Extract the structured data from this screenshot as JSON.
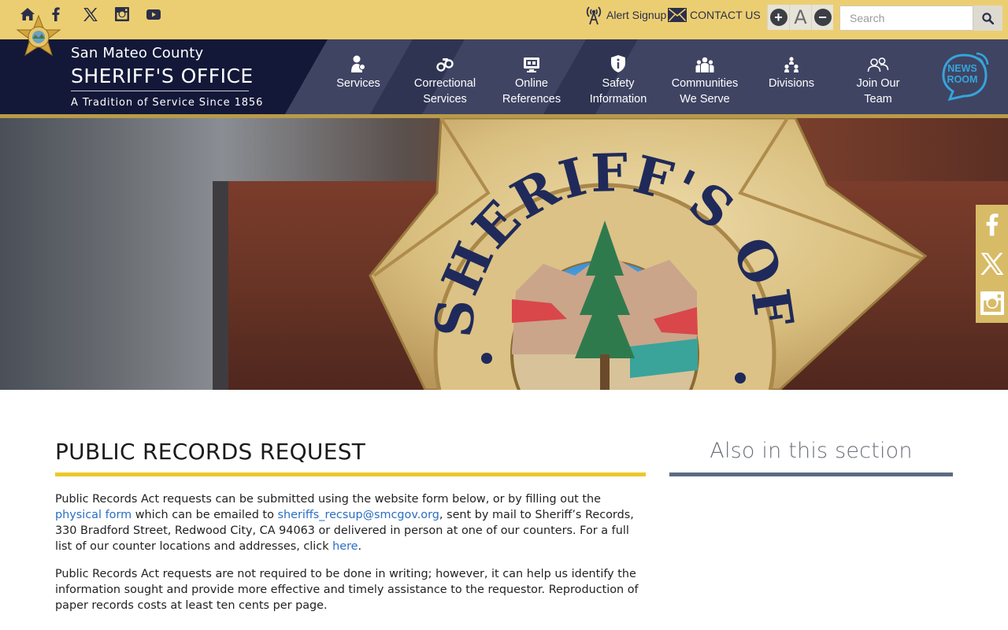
{
  "topbar": {
    "social_icons": [
      "home-icon",
      "facebook-icon",
      "x-icon",
      "instagram-icon",
      "youtube-icon"
    ],
    "alert_signup": "Alert Signup",
    "contact_us": "CONTACT US",
    "font_larger": "+",
    "font_default": "A",
    "font_smaller": "−",
    "search_placeholder": "Search"
  },
  "brand": {
    "county": "San Mateo County",
    "office": "SHERIFF'S OFFICE",
    "tagline": "A Tradition of Service Since 1856"
  },
  "nav": {
    "items": [
      {
        "line1": "Services",
        "line2": ""
      },
      {
        "line1": "Correctional",
        "line2": "Services"
      },
      {
        "line1": "Online",
        "line2": "References"
      },
      {
        "line1": "Safety",
        "line2": "Information"
      },
      {
        "line1": "Communities",
        "line2": "We Serve"
      },
      {
        "line1": "Divisions",
        "line2": ""
      },
      {
        "line1": "Join Our",
        "line2": "Team"
      }
    ],
    "newsroom_line1": "NEWS",
    "newsroom_line2": "ROOM"
  },
  "hero": {
    "badge_text": "SHERIFF'S OFFICE"
  },
  "side_social": [
    "facebook-icon",
    "x-icon",
    "instagram-icon"
  ],
  "main": {
    "title": "PUBLIC RECORDS REQUEST",
    "p1_a": "Public Records Act requests can be submitted using the website form below, or by filling out the ",
    "p1_link1": "physical form",
    "p1_b": " which can be emailed to ",
    "p1_link2": "sheriffs_recsup@smcgov.org",
    "p1_c": ", sent by mail to Sheriff’s Records, 330 Bradford Street, Redwood City, CA 94063 or delivered in person at one of our counters. For a full list of our counter locations and addresses, click ",
    "p1_link3": "here",
    "p1_d": ".",
    "p2": "Public Records Act requests are not required to be done in writing; however, it can help us identify the information sought and provide more effective and timely assistance to the requestor. Reproduction of paper records costs at least ten cents per page."
  },
  "aside": {
    "title": "Also in this section"
  },
  "colors": {
    "topbar": "#ecce72",
    "nav_dark": "#131838",
    "nav": "#3f4463",
    "gold_line": "#b89a4a",
    "title_rule": "#eec72c",
    "aside_rule": "#5b6b80",
    "link": "#2a6ec2"
  }
}
